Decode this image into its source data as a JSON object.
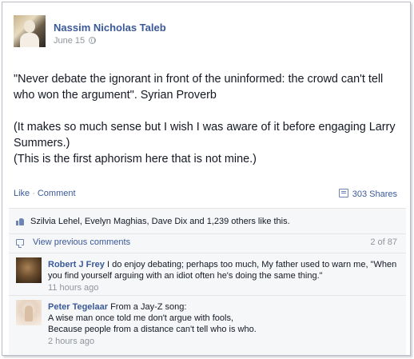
{
  "post": {
    "author": "Nassim Nicholas Taleb",
    "date": "June 15",
    "paragraphs": [
      "\"Never debate the ignorant in front of the uninformed: the crowd can't tell who won the argument\". Syrian Proverb",
      "(It makes so much sense but I wish I was aware of it before engaging Larry Summers.)\n(This is the first aphorism here that is not mine.)"
    ]
  },
  "actions": {
    "like": "Like",
    "separator": "·",
    "comment": "Comment",
    "shares": "303 Shares"
  },
  "ufi": {
    "likes_text": "Szilvia Lehel, Evelyn Maghias, Dave Dix and 1,239 others like this.",
    "view_previous": "View previous comments",
    "comment_count": "2 of 87",
    "comments": [
      {
        "name": "Robert J Frey",
        "text": " I do enjoy debating; perhaps too much, My father used to warn me, \"When you find yourself arguing with an idiot often he's doing the same thing.\"",
        "time": "11 hours ago"
      },
      {
        "name": "Peter Tegelaar",
        "text": " From a Jay-Z song:\nA wise man once told me don't argue with fools,\nBecause people from a distance can't tell who is who.",
        "time": "2 hours ago"
      }
    ]
  },
  "icons": {
    "audience": "globe-icon",
    "shares": "share-icon",
    "likes": "thumbs-up-icon",
    "comments": "comment-bubble-icon"
  },
  "colors": {
    "link": "#3b5998",
    "muted": "#90949c",
    "panel": "#f6f7f9"
  }
}
